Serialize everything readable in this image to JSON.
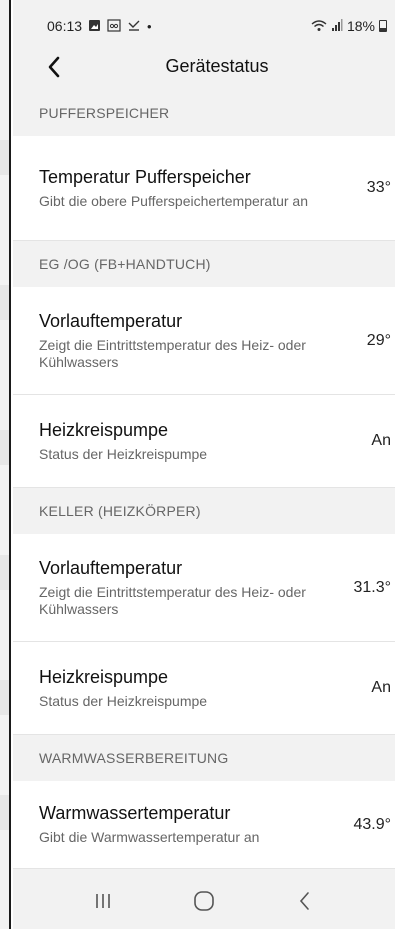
{
  "status_bar": {
    "time": "06:13",
    "icons_left": [
      "gallery-icon",
      "voicemail-icon",
      "missed-call-icon",
      "dot-icon"
    ],
    "battery_text": "18%"
  },
  "header": {
    "title": "Gerätestatus"
  },
  "sections": [
    {
      "title": "PUFFERSPEICHER",
      "rows": [
        {
          "title": "Temperatur Pufferspeicher",
          "description": "Gibt die obere Pufferspeichertemperatur an",
          "value": "33°"
        }
      ]
    },
    {
      "title": "EG /OG (FB+HANDTUCH)",
      "rows": [
        {
          "title": "Vorlauftemperatur",
          "description": "Zeigt die Eintrittstemperatur des Heiz- oder Kühlwassers",
          "value": "29°"
        },
        {
          "title": "Heizkreispumpe",
          "description": "Status der Heizkreispumpe",
          "value": "An"
        }
      ]
    },
    {
      "title": "KELLER (HEIZKÖRPER)",
      "rows": [
        {
          "title": "Vorlauftemperatur",
          "description": "Zeigt die Eintrittstemperatur des Heiz- oder Kühlwassers",
          "value": "31.3°"
        },
        {
          "title": "Heizkreispumpe",
          "description": "Status der Heizkreispumpe",
          "value": "An"
        }
      ]
    },
    {
      "title": "WARMWASSERBEREITUNG",
      "rows": [
        {
          "title": "Warmwassertemperatur",
          "description": "Gibt die Warmwassertemperatur an",
          "value": "43.9°"
        }
      ]
    }
  ],
  "colors": {
    "background": "#f2f2f2",
    "card": "#ffffff",
    "secondary_text": "#666666"
  }
}
